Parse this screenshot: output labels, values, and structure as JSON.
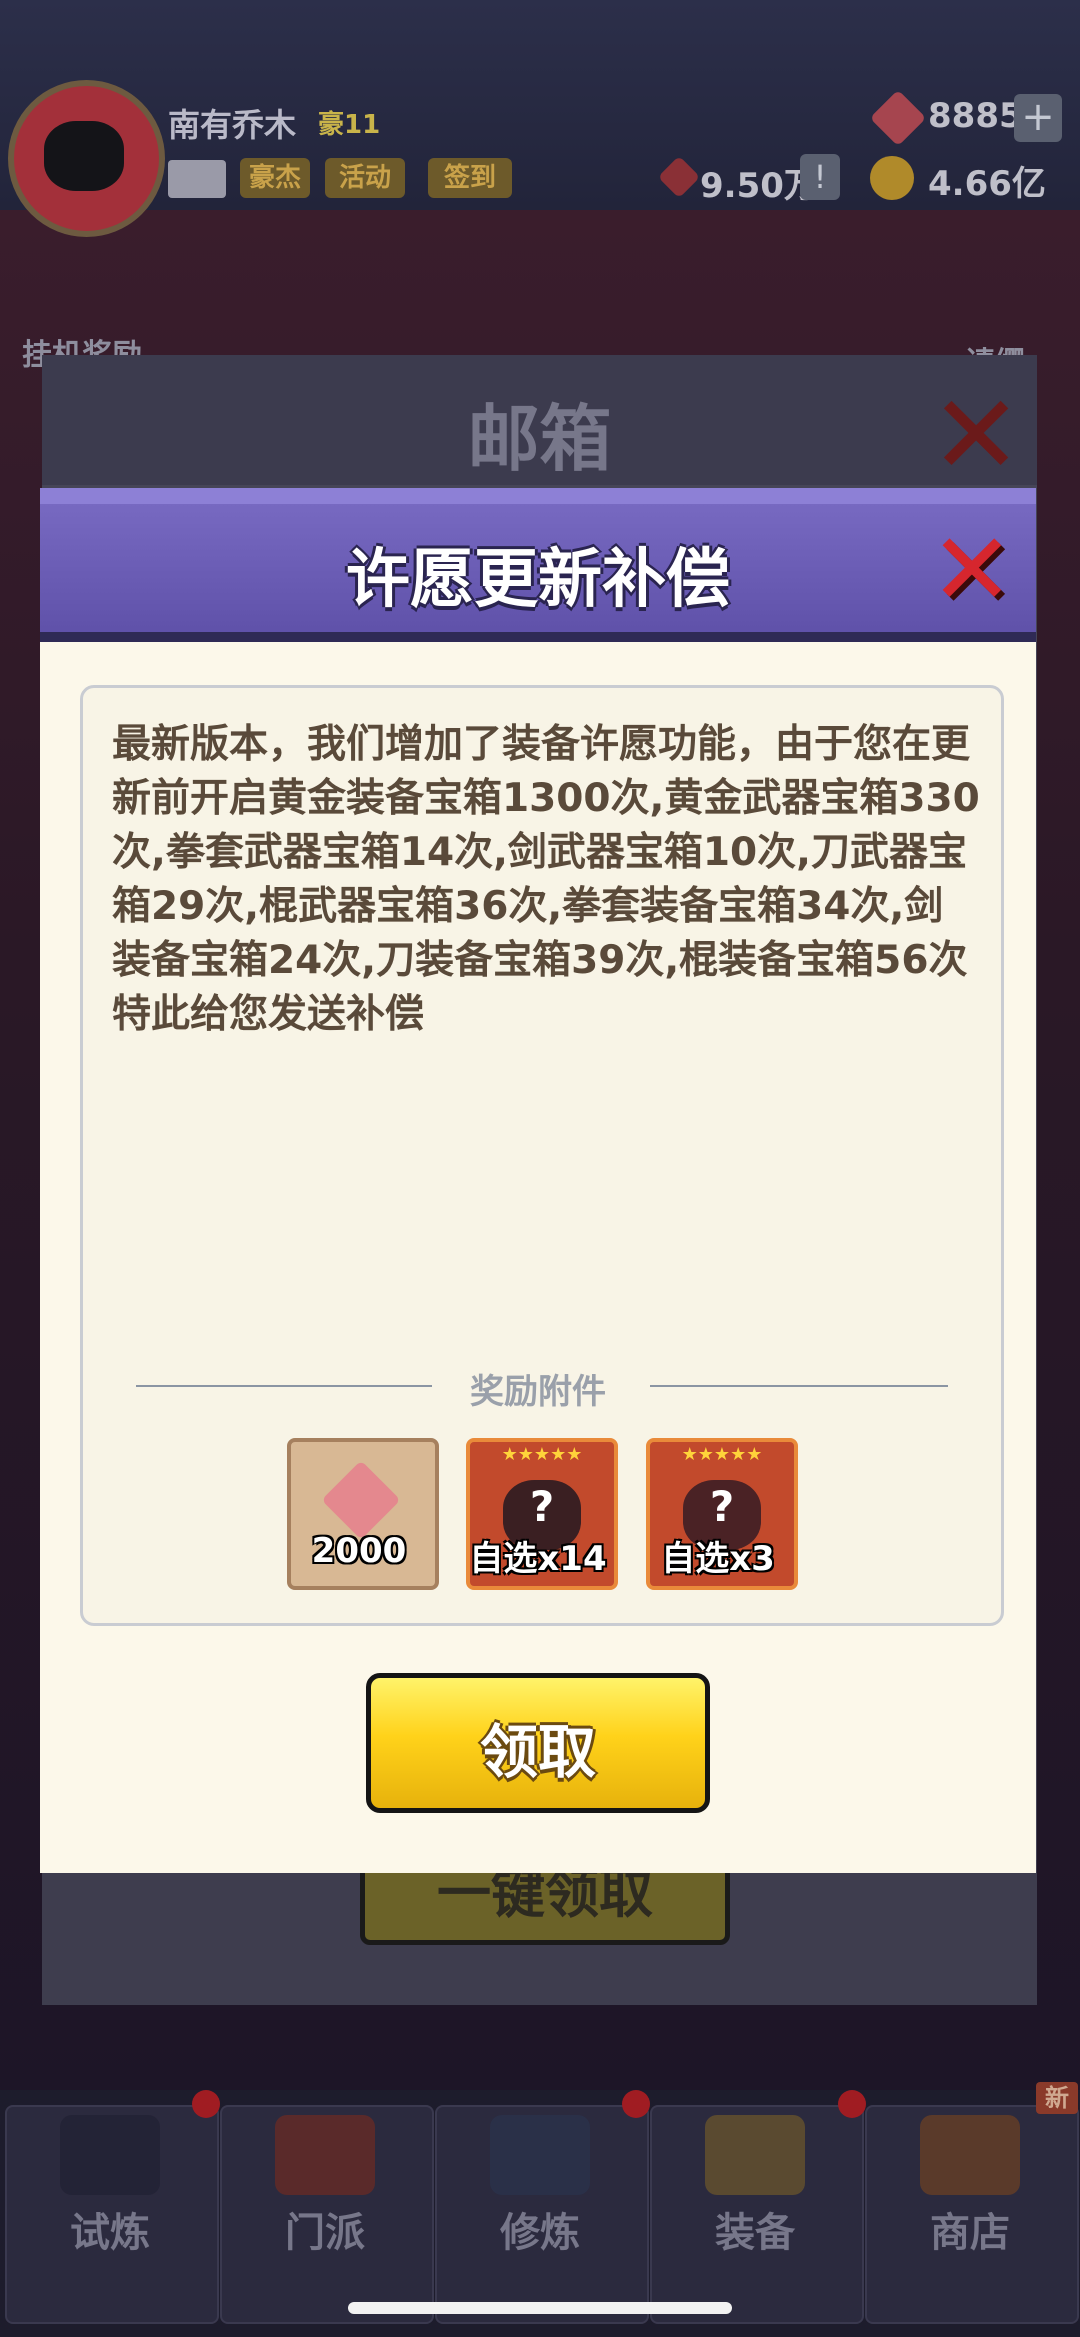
{
  "top": {
    "username": "南有乔木",
    "vip": "豪11",
    "chips": [
      "豪杰",
      "活动",
      "签到"
    ],
    "gems": "8885",
    "power": "9.50万",
    "gold": "4.66亿",
    "left_side": "挂机奖励",
    "right_side": "请缨"
  },
  "mailbox": {
    "title": "邮箱",
    "footer_button": "一键领取"
  },
  "dialog": {
    "title": "许愿更新补偿",
    "message": "最新版本，我们增加了装备许愿功能，由于您在更新前开启黄金装备宝箱1300次,黄金武器宝箱330次,拳套武器宝箱14次,剑武器宝箱10次,刀武器宝箱29次,棍武器宝箱36次,拳套装备宝箱34次,剑装备宝箱24次,刀装备宝箱39次,棍装备宝箱56次特此给您发送补偿",
    "attachments_label": "奖励附件",
    "attachments": [
      {
        "icon": "gem-icon",
        "label": "2000"
      },
      {
        "icon": "mystery-armor-icon",
        "label": "自选x14",
        "stars": "★★★★★"
      },
      {
        "icon": "mystery-weapon-icon",
        "label": "自选x3",
        "stars": "★★★★★"
      }
    ],
    "claim_label": "领取"
  },
  "nav": {
    "items": [
      "试炼",
      "门派",
      "修炼",
      "装备",
      "商店"
    ],
    "new_badge": "新"
  },
  "colors": {
    "header_purple": "#6a5cb8",
    "claim_yellow": "#ffd21a",
    "close_red": "#d6262e"
  }
}
